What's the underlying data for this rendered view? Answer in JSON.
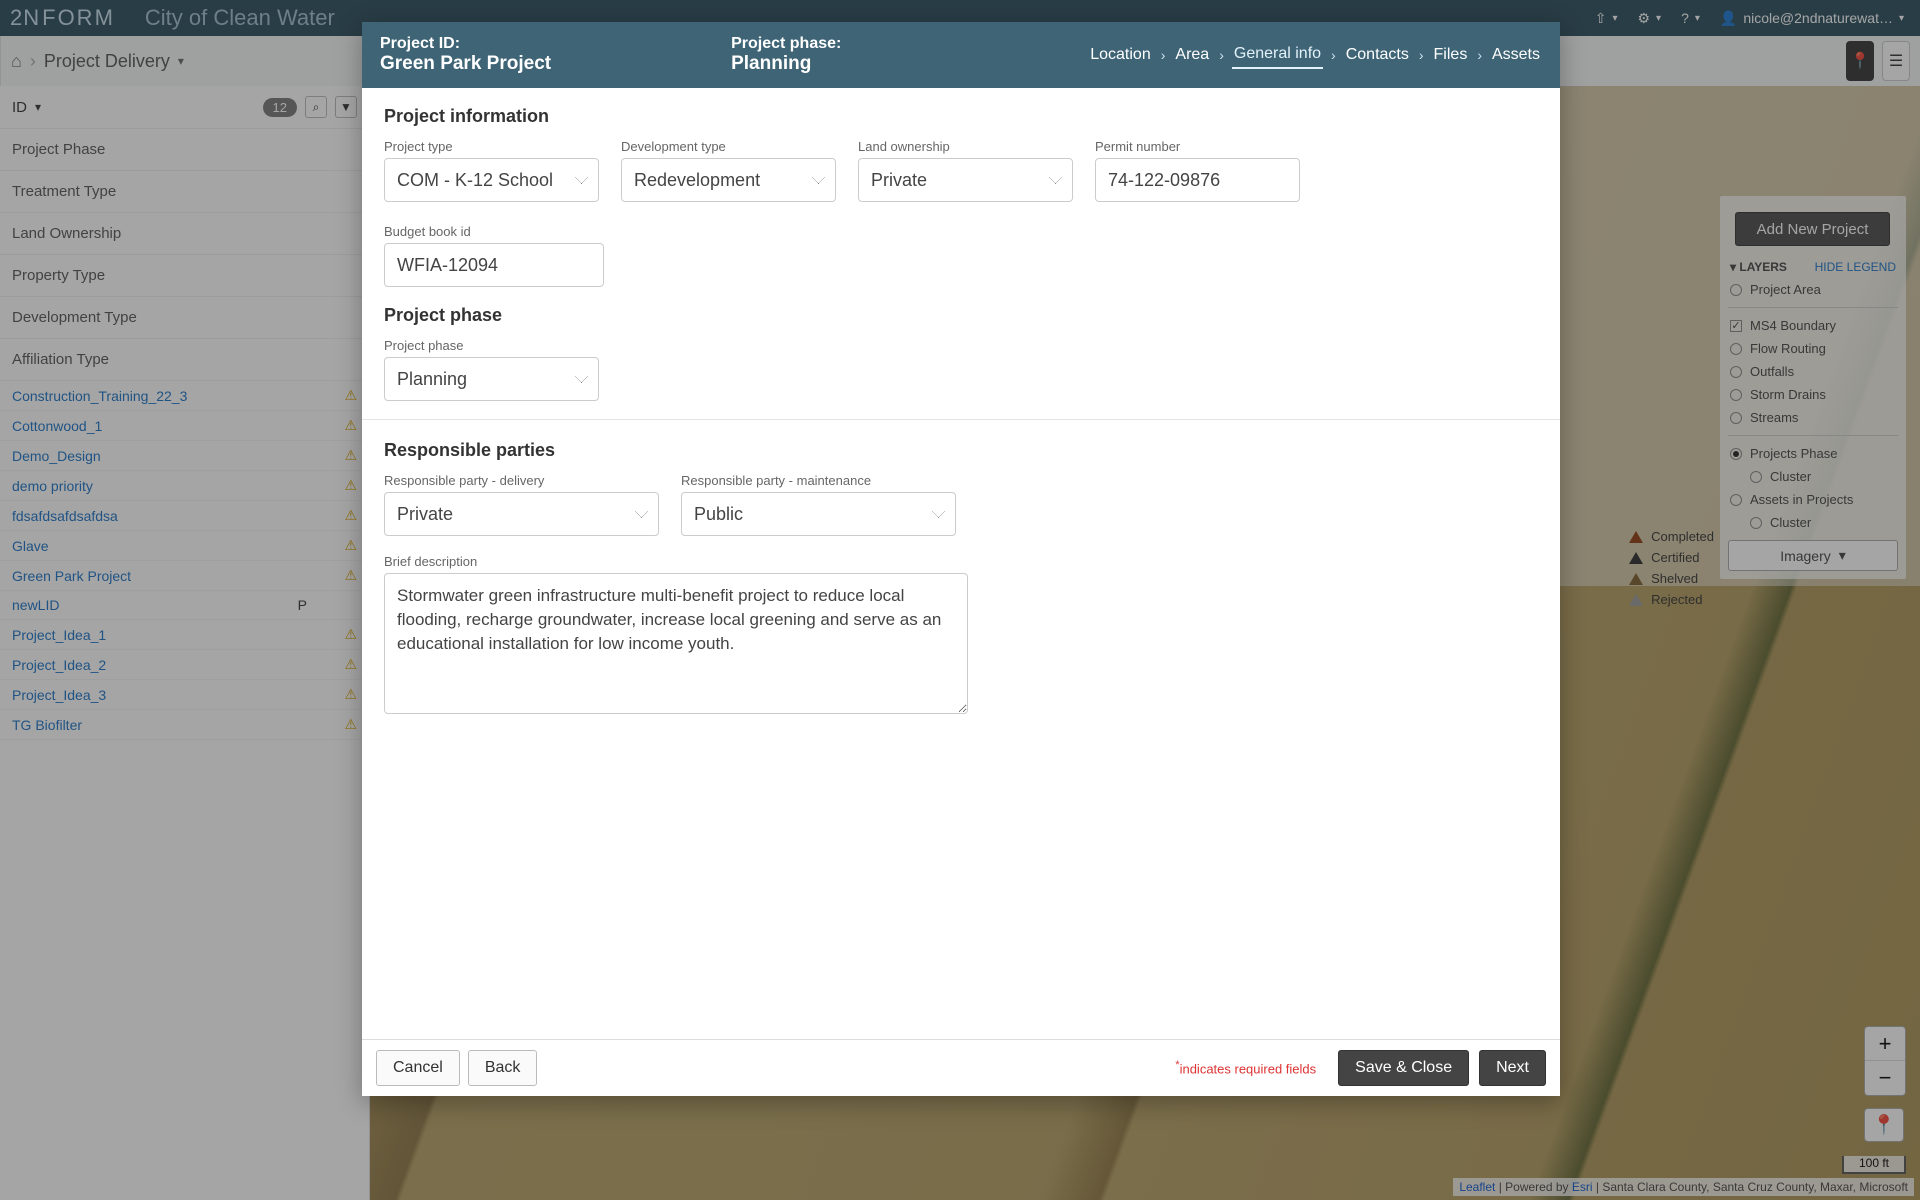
{
  "header": {
    "brand_prefix": "2N",
    "brand_suffix": "FORM",
    "city": "City of Clean Water",
    "username": "nicole@2ndnaturewat…"
  },
  "breadcrumbs": {
    "project_delivery": "Project Delivery"
  },
  "sidebar": {
    "id_label": "ID",
    "count": "12",
    "categories": [
      "Project Phase",
      "Treatment Type",
      "Land Ownership",
      "Property Type",
      "Development Type",
      "Affiliation Type"
    ],
    "projects": [
      {
        "name": "Construction_Training_22_3",
        "warn": true
      },
      {
        "name": "Cottonwood_1",
        "warn": true
      },
      {
        "name": "Demo_Design",
        "warn": true
      },
      {
        "name": "demo priority",
        "warn": true
      },
      {
        "name": "fdsafdsafdsafdsa",
        "warn": true
      },
      {
        "name": "Glave",
        "warn": true
      },
      {
        "name": "Green Park Project",
        "warn": true
      },
      {
        "name": "newLID",
        "flag": "P",
        "warn": true
      },
      {
        "name": "Project_Idea_1",
        "warn": true
      },
      {
        "name": "Project_Idea_2",
        "warn": true
      },
      {
        "name": "Project_Idea_3",
        "warn": true
      },
      {
        "name": "TG Biofilter",
        "warn": true
      }
    ]
  },
  "map": {
    "add_new": "Add New Project",
    "attribution_leaflet": "Leaflet",
    "attribution_mid": " | Powered by ",
    "attribution_esri": "Esri",
    "attribution_rest": " | Santa Clara County, Santa Cruz County, Maxar, Microsoft",
    "scale": "100 ft"
  },
  "status_legend": [
    "Completed",
    "Certified",
    "Shelved",
    "Rejected"
  ],
  "layers_panel": {
    "title": "LAYERS",
    "hide": "HIDE LEGEND",
    "items": [
      "Project Area",
      "MS4 Boundary",
      "Flow Routing",
      "Outfalls",
      "Storm Drains",
      "Streams",
      "Projects Phase",
      "Cluster",
      "Assets in Projects",
      "Cluster"
    ],
    "imagery": "Imagery"
  },
  "modal": {
    "title_label": "Project ID:",
    "title_value": "Green Park Project",
    "phase_label": "Project phase:",
    "phase_value": "Planning",
    "tabs": [
      "Location",
      "Area",
      "General info",
      "Contacts",
      "Files",
      "Assets"
    ],
    "section_project_info": "Project information",
    "section_project_phase": "Project phase",
    "section_responsible": "Responsible parties",
    "labels": {
      "project_type": "Project type",
      "development_type": "Development type",
      "land_ownership": "Land ownership",
      "permit_number": "Permit number",
      "budget_book": "Budget book id",
      "project_phase": "Project phase",
      "resp_delivery": "Responsible party - delivery",
      "resp_maintenance": "Responsible party - maintenance",
      "brief_description": "Brief description"
    },
    "values": {
      "project_type": "COM - K-12 School",
      "development_type": "Redevelopment",
      "land_ownership": "Private",
      "permit_number": "74-122-09876",
      "budget_book": "WFIA-12094",
      "project_phase": "Planning",
      "resp_delivery": "Private",
      "resp_maintenance": "Public",
      "brief_description": "Stormwater green infrastructure multi-benefit project to reduce local flooding, recharge groundwater, increase local greening and serve as an educational installation for low income youth."
    },
    "footer": {
      "cancel": "Cancel",
      "back": "Back",
      "required": "indicates required fields",
      "save_close": "Save & Close",
      "next": "Next"
    }
  }
}
